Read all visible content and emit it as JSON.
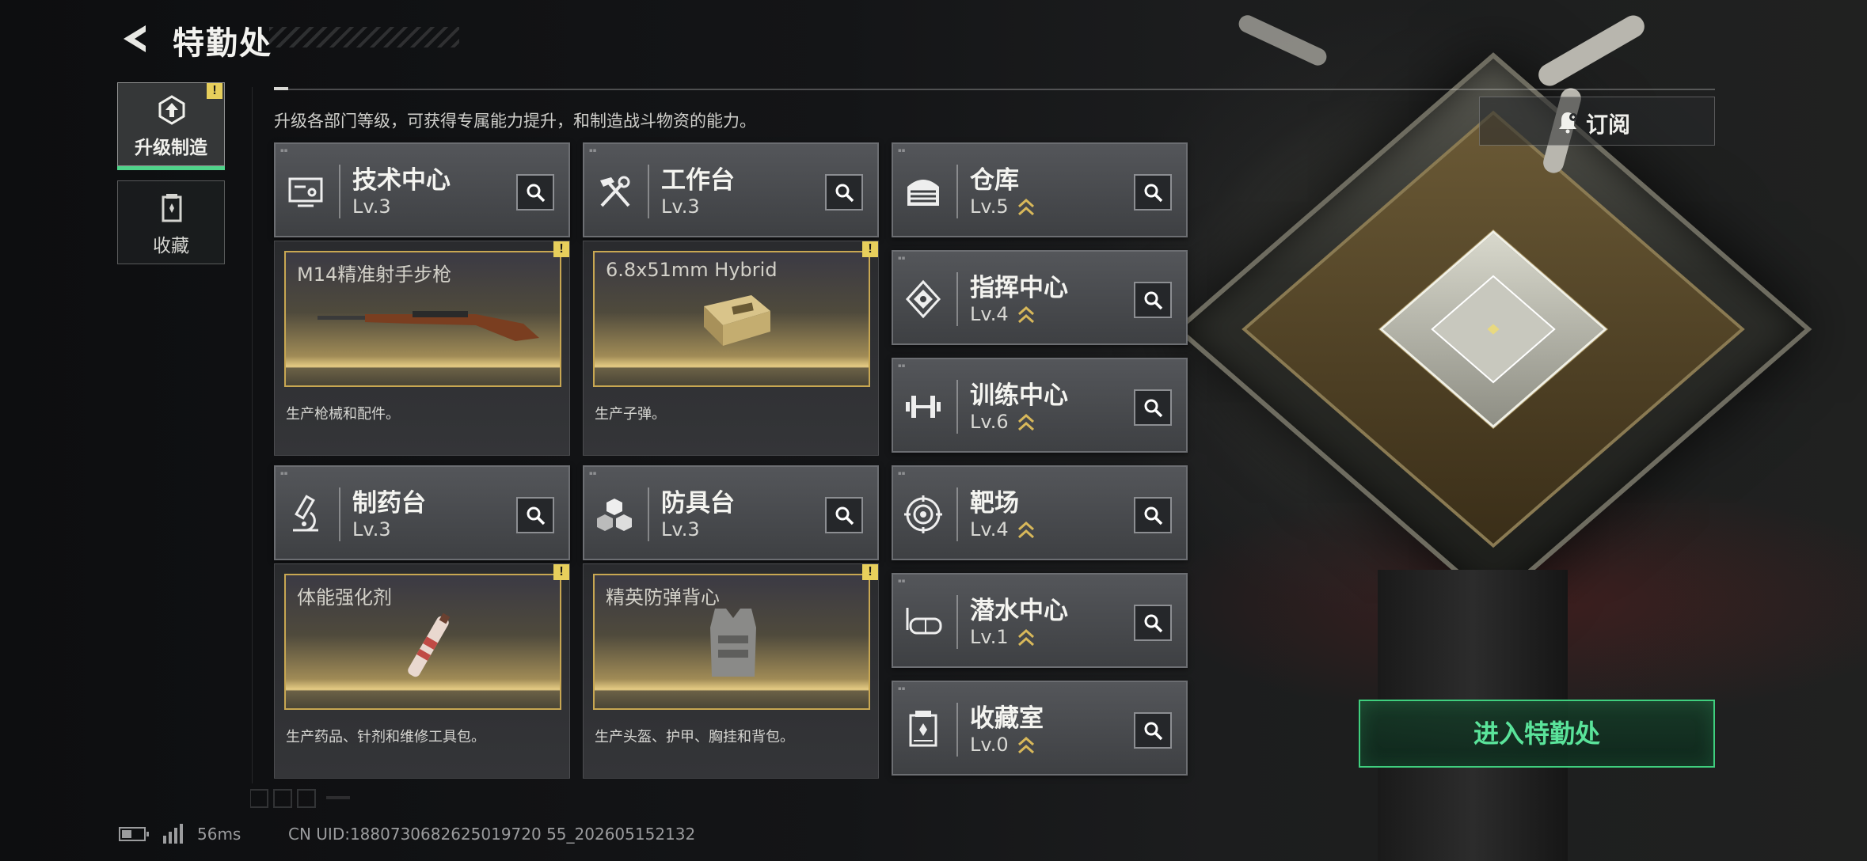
{
  "header": {
    "title": "特勤处",
    "subtitle": "升级各部门等级，可获得专属能力提升，和制造战斗物资的能力。"
  },
  "side_tabs": [
    {
      "label": "升级制造",
      "icon": "upgrade-icon",
      "active": true,
      "badge": "!"
    },
    {
      "label": "收藏",
      "icon": "collection-icon",
      "active": false
    }
  ],
  "departments_main": [
    {
      "name": "技术中心",
      "level": "Lv.3",
      "icon": "tech-center-icon",
      "product": {
        "name": "M14精准射手步枪",
        "desc": "生产枪械和配件。",
        "badge": "!"
      }
    },
    {
      "name": "工作台",
      "level": "Lv.3",
      "icon": "workbench-icon",
      "product": {
        "name": "6.8x51mm Hybrid",
        "desc": "生产子弹。",
        "badge": "!"
      }
    },
    {
      "name": "制药台",
      "level": "Lv.3",
      "icon": "pharmacy-icon",
      "product": {
        "name": "体能强化剂",
        "desc": "生产药品、针剂和维修工具包。",
        "badge": "!"
      }
    },
    {
      "name": "防具台",
      "level": "Lv.3",
      "icon": "armor-bench-icon",
      "product": {
        "name": "精英防弹背心",
        "desc": "生产头盔、护甲、胸挂和背包。",
        "badge": "!"
      }
    }
  ],
  "departments_side": [
    {
      "name": "仓库",
      "level": "Lv.5",
      "icon": "warehouse-icon",
      "upgradable": true
    },
    {
      "name": "指挥中心",
      "level": "Lv.4",
      "icon": "command-center-icon",
      "upgradable": true
    },
    {
      "name": "训练中心",
      "level": "Lv.6",
      "icon": "training-center-icon",
      "upgradable": true
    },
    {
      "name": "靶场",
      "level": "Lv.4",
      "icon": "shooting-range-icon",
      "upgradable": true
    },
    {
      "name": "潜水中心",
      "level": "Lv.1",
      "icon": "diving-center-icon",
      "upgradable": true
    },
    {
      "name": "收藏室",
      "level": "Lv.0",
      "icon": "collection-room-icon",
      "upgradable": true
    }
  ],
  "subscribe": {
    "label": "订阅",
    "icon": "bell-icon"
  },
  "enter_button": {
    "label": "进入特勤处"
  },
  "status_bar": {
    "ping": "56ms",
    "uid": "CN UID:1880730682625019720 55_202605152132"
  },
  "colors": {
    "accent_green": "#3fcf7e",
    "warn_yellow": "#e7cf5c",
    "gold_border": "#c8a752",
    "upgrade_chevron": "#d8b85a"
  }
}
